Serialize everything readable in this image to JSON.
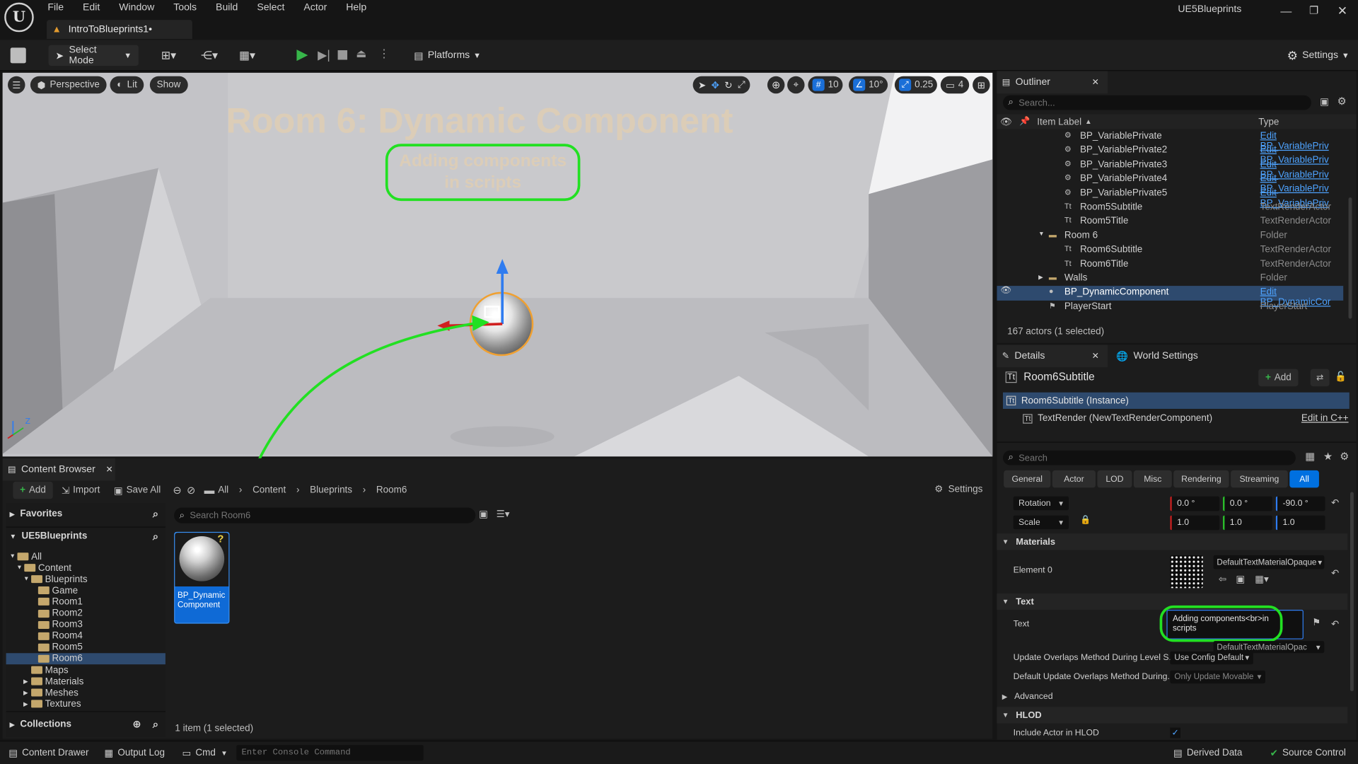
{
  "window": {
    "title": "UE5Blueprints",
    "project_tab": "IntroToBlueprints1•"
  },
  "menu": [
    "File",
    "Edit",
    "Window",
    "Tools",
    "Build",
    "Select",
    "Actor",
    "Help"
  ],
  "toolbar": {
    "select_mode": "Select Mode",
    "platforms": "Platforms",
    "settings": "Settings"
  },
  "viewport": {
    "perspective": "Perspective",
    "lit": "Lit",
    "show": "Show",
    "grid_snap": "10",
    "rot_snap": "10°",
    "scale_snap": "0.25",
    "camera_speed": "4",
    "room_title": "Room 6: Dynamic Component",
    "subtitle_line1": "Adding components",
    "subtitle_line2": "in scripts"
  },
  "outliner": {
    "tab": "Outliner",
    "search_placeholder": "Search...",
    "col_label": "Item Label",
    "col_type": "Type",
    "rows": [
      {
        "name": "BP_VariablePrivate",
        "type": "Edit BP_VariablePriv",
        "link": true,
        "indent": 4,
        "icon": "bp"
      },
      {
        "name": "BP_VariablePrivate2",
        "type": "Edit BP_VariablePriv",
        "link": true,
        "indent": 4,
        "icon": "bp"
      },
      {
        "name": "BP_VariablePrivate3",
        "type": "Edit BP_VariablePriv",
        "link": true,
        "indent": 4,
        "icon": "bp"
      },
      {
        "name": "BP_VariablePrivate4",
        "type": "Edit BP_VariablePriv",
        "link": true,
        "indent": 4,
        "icon": "bp"
      },
      {
        "name": "BP_VariablePrivate5",
        "type": "Edit BP_VariablePriv",
        "link": true,
        "indent": 4,
        "icon": "bp"
      },
      {
        "name": "Room5Subtitle",
        "type": "TextRenderActor",
        "link": false,
        "indent": 4,
        "icon": "text"
      },
      {
        "name": "Room5Title",
        "type": "TextRenderActor",
        "link": false,
        "indent": 4,
        "icon": "text"
      },
      {
        "name": "Room 6",
        "type": "Folder",
        "link": false,
        "indent": 3,
        "icon": "folder"
      },
      {
        "name": "Room6Subtitle",
        "type": "TextRenderActor",
        "link": false,
        "indent": 4,
        "icon": "text"
      },
      {
        "name": "Room6Title",
        "type": "TextRenderActor",
        "link": false,
        "indent": 4,
        "icon": "text"
      },
      {
        "name": "Walls",
        "type": "Folder",
        "link": false,
        "indent": 3,
        "icon": "folder"
      },
      {
        "name": "BP_DynamicComponent",
        "type": "Edit BP_DynamicCor",
        "link": true,
        "indent": 3,
        "icon": "sphere",
        "selected": true
      },
      {
        "name": "PlayerStart",
        "type": "PlayerStart",
        "link": false,
        "indent": 3,
        "icon": "flag"
      }
    ],
    "footer": "167 actors (1 selected)"
  },
  "details": {
    "tab": "Details",
    "world_settings_tab": "World Settings",
    "actor_name": "Room6Subtitle",
    "add_button": "Add",
    "instance": "Room6Subtitle (Instance)",
    "component": "TextRender (NewTextRenderComponent)",
    "edit_cpp": "Edit in C++",
    "search_placeholder": "Search",
    "categories": [
      "General",
      "Actor",
      "LOD",
      "Misc",
      "Rendering",
      "Streaming",
      "All"
    ],
    "rotation_label": "Rotation",
    "rotation": [
      "0.0 °",
      "0.0 °",
      "-90.0 °"
    ],
    "scale_label": "Scale",
    "scale": [
      "1.0",
      "1.0",
      "1.0"
    ],
    "materials_section": "Materials",
    "element0_label": "Element 0",
    "material": "DefaultTextMaterialOpaque",
    "text_section": "Text",
    "text_label": "Text",
    "text_value_line1": "Adding components<br>in",
    "text_value_line2": "scripts",
    "update_overlaps_label": "Update Overlaps Method During Level S...",
    "update_overlaps_value": "Use Config Default",
    "material_behind": "DefaultTextMaterialOpac",
    "default_update_label": "Default Update Overlaps Method During...",
    "default_update_value": "Only Update Movable",
    "advanced": "Advanced",
    "hlod_section": "HLOD",
    "include_hlod_label": "Include Actor in HLOD"
  },
  "content_browser": {
    "tab": "Content Browser",
    "add": "Add",
    "import": "Import",
    "save_all": "Save All",
    "breadcrumb": [
      "All",
      "Content",
      "Blueprints",
      "Room6"
    ],
    "settings": "Settings",
    "favorites": "Favorites",
    "project": "UE5Blueprints",
    "search_placeholder": "Search Room6",
    "tree": [
      {
        "label": "All",
        "level": 0,
        "expanded": true
      },
      {
        "label": "Content",
        "level": 1,
        "expanded": true
      },
      {
        "label": "Blueprints",
        "level": 2,
        "expanded": true
      },
      {
        "label": "Game",
        "level": 3
      },
      {
        "label": "Room1",
        "level": 3
      },
      {
        "label": "Room2",
        "level": 3
      },
      {
        "label": "Room3",
        "level": 3
      },
      {
        "label": "Room4",
        "level": 3
      },
      {
        "label": "Room5",
        "level": 3
      },
      {
        "label": "Room6",
        "level": 3,
        "selected": true
      },
      {
        "label": "Maps",
        "level": 2
      },
      {
        "label": "Materials",
        "level": 2,
        "collapsed": true
      },
      {
        "label": "Meshes",
        "level": 2,
        "collapsed": true
      },
      {
        "label": "Textures",
        "level": 2,
        "collapsed": true
      }
    ],
    "collections": "Collections",
    "asset_name_line1": "BP_Dynamic",
    "asset_name_line2": "Component",
    "item_count": "1 item (1 selected)"
  },
  "statusbar": {
    "content_drawer": "Content Drawer",
    "output_log": "Output Log",
    "cmd": "Cmd",
    "console_placeholder": "Enter Console Command",
    "derived_data": "Derived Data",
    "source_control": "Source Control"
  },
  "colors": {
    "accent": "#0070e0",
    "highlight_green": "#22e022",
    "selection": "#2e4a6e",
    "play_green": "#37b64a"
  }
}
